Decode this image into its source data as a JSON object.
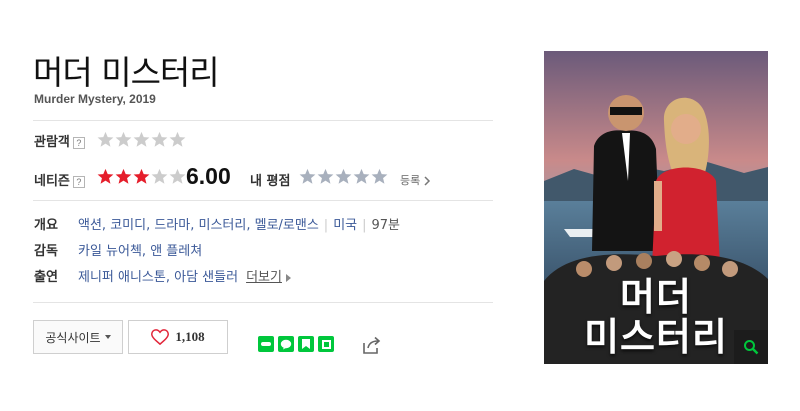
{
  "movie": {
    "title": "머더 미스터리",
    "subtitle": "Murder Mystery, 2019"
  },
  "ratings": {
    "audience_label": "관람객",
    "netizen_label": "네티즌",
    "help_mark": "?",
    "audience_stars": 0,
    "netizen_stars": 3,
    "netizen_score": "6.00",
    "my_rating_label": "내 평점",
    "my_stars": 0,
    "register_link": "등록",
    "star_color_on": "#e51e2b",
    "star_color_off": "#cccccc"
  },
  "info": {
    "genre_label": "개요",
    "genres": [
      "액션",
      "코미디",
      "드라마",
      "미스터리",
      "멜로/로맨스"
    ],
    "country": "미국",
    "runtime": "97분",
    "director_label": "감독",
    "directors": "카일 뉴어첵, 앤 플레쳐",
    "cast_label": "출연",
    "cast": "제니퍼 애니스톤, 아담 샌들러",
    "more_link": "더보기"
  },
  "actions": {
    "official_site": "공식사이트",
    "like_count": "1,108",
    "share_icons": [
      "band-icon",
      "line-icon",
      "bookmark-icon",
      "memo-icon"
    ],
    "brand_green": "#00c73c"
  },
  "poster": {
    "title_line1": "머더",
    "title_line2": "미스터리"
  }
}
